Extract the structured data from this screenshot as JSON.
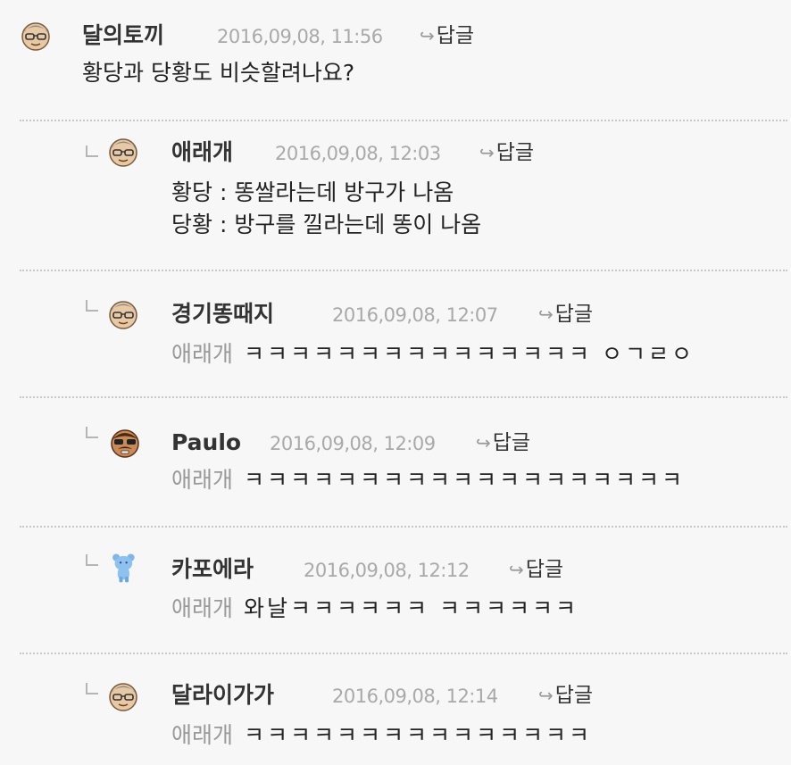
{
  "comments": [
    {
      "author": "달의토끼",
      "date": "2016,09,08, 11:56",
      "reply_label": "답글",
      "lines": [
        "황당과 당황도 비슷할려나요?"
      ],
      "avatar": "glasses-face"
    },
    {
      "author": "애래개",
      "date": "2016,09,08, 12:03",
      "reply_label": "답글",
      "lines": [
        "황당 : 똥쌀라는데 방구가 나옴",
        "당황 : 방구를 낄라는데 똥이 나옴"
      ],
      "avatar": "glasses-face"
    },
    {
      "author": "경기똥때지",
      "date": "2016,09,08, 12:07",
      "reply_label": "답글",
      "mention": "애래개",
      "text": "ㅋㅋㅋㅋㅋㅋㅋㅋㅋㅋㅋㅋㅋㅋㅋ ㅇㄱㄹㅇ",
      "avatar": "glasses-face"
    },
    {
      "author": "Paulo",
      "date": "2016,09,08, 12:09",
      "reply_label": "답글",
      "mention": "애래개",
      "text": "ㅋㅋㅋㅋㅋㅋㅋㅋㅋㅋㅋㅋㅋㅋㅋㅋㅋㅋㅋ",
      "avatar": "mustache-face"
    },
    {
      "author": "카포에라",
      "date": "2016,09,08, 12:12",
      "reply_label": "답글",
      "mention": "애래개",
      "text": "와날ㅋㅋㅋㅋㅋㅋ ㅋㅋㅋㅋㅋㅋ",
      "avatar": "blue-bear"
    },
    {
      "author": "달라이가가",
      "date": "2016,09,08, 12:14",
      "reply_label": "답글",
      "mention": "애래개",
      "text": "ㅋㅋㅋㅋㅋㅋㅋㅋㅋㅋㅋㅋㅋㅋㅋ",
      "avatar": "glasses-face"
    }
  ],
  "colors": {
    "background": "#f7f7f7",
    "author": "#333333",
    "date": "#a9a9a9",
    "mention": "#999999",
    "divider": "#c9c9c9"
  }
}
